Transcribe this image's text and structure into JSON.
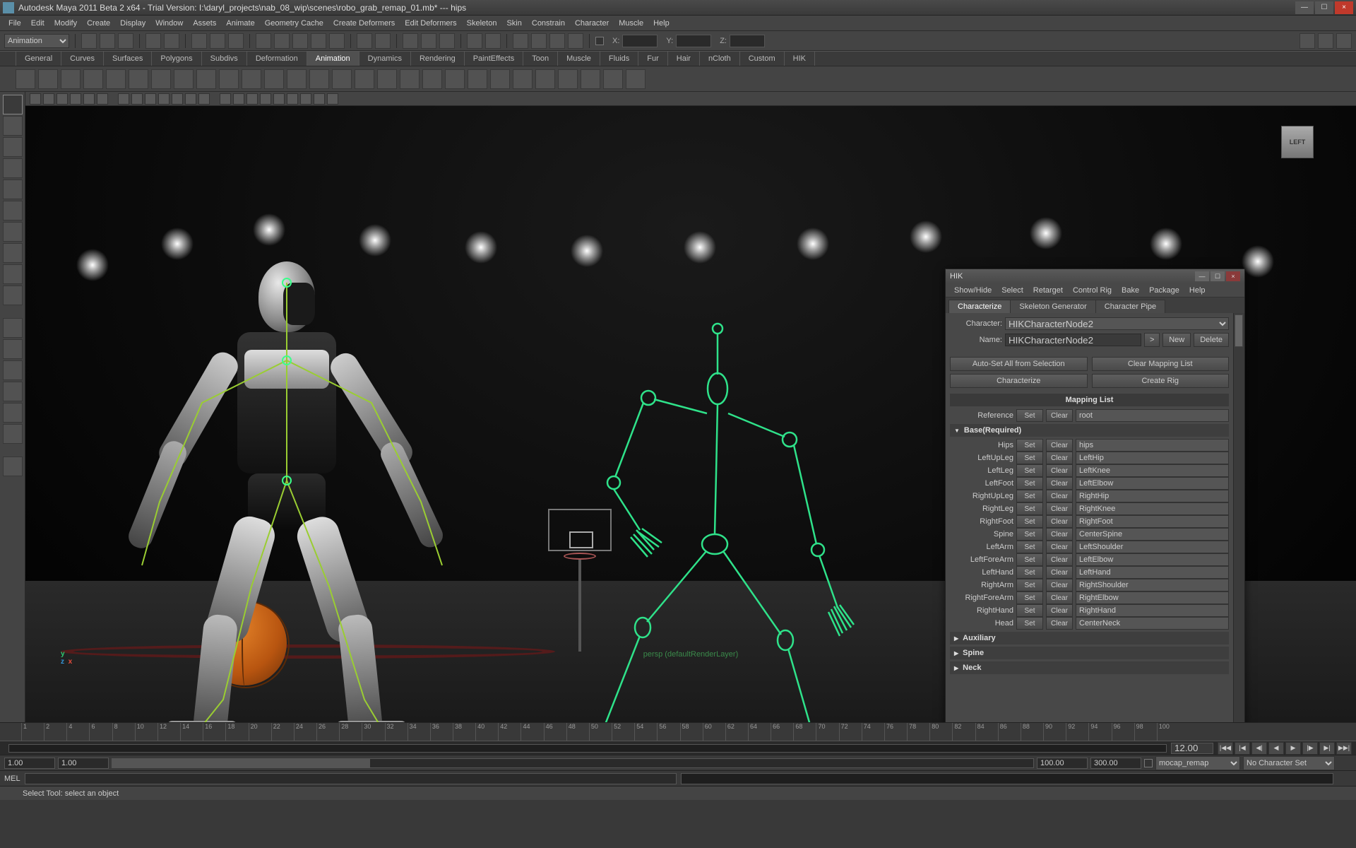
{
  "title": "Autodesk Maya 2011 Beta 2 x64 - Trial Version: I:\\daryl_projects\\nab_08_wip\\scenes\\robo_grab_remap_01.mb*  ---  hips",
  "menubar": [
    "File",
    "Edit",
    "Modify",
    "Create",
    "Display",
    "Window",
    "Assets",
    "Animate",
    "Geometry Cache",
    "Create Deformers",
    "Edit Deformers",
    "Skeleton",
    "Skin",
    "Constrain",
    "Character",
    "Muscle",
    "Help"
  ],
  "modeSelector": "Animation",
  "xyz": {
    "x": "X:",
    "y": "Y:",
    "z": "Z:"
  },
  "shelves": [
    "General",
    "Curves",
    "Surfaces",
    "Polygons",
    "Subdivs",
    "Deformation",
    "Animation",
    "Dynamics",
    "Rendering",
    "PaintEffects",
    "Toon",
    "Muscle",
    "Fluids",
    "Fur",
    "Hair",
    "nCloth",
    "Custom",
    "HIK"
  ],
  "activeShelf": "Animation",
  "viewcube": "LEFT",
  "camlabel": "persp (defaultRenderLayer)",
  "hik": {
    "title": "HIK",
    "menu": [
      "Show/Hide",
      "Select",
      "Retarget",
      "Control Rig",
      "Bake",
      "Package",
      "Help"
    ],
    "tabs": [
      "Characterize",
      "Skeleton Generator",
      "Character Pipe"
    ],
    "activeTab": "Characterize",
    "characterLabel": "Character:",
    "character": "HIKCharacterNode2",
    "nameLabel": "Name:",
    "name": "HIKCharacterNode2",
    "go": ">",
    "newBtn": "New",
    "deleteBtn": "Delete",
    "autoset": "Auto-Set All from Selection",
    "clearmap": "Clear Mapping List",
    "characterize": "Characterize",
    "createrig": "Create Rig",
    "maplist": "Mapping List",
    "setBtn": "Set",
    "clearBtn": "Clear",
    "refLabel": "Reference",
    "refVal": "root",
    "baseHdr": "Base(Required)",
    "rows": [
      {
        "l": "Hips",
        "v": "hips"
      },
      {
        "l": "LeftUpLeg",
        "v": "LeftHip"
      },
      {
        "l": "LeftLeg",
        "v": "LeftKnee"
      },
      {
        "l": "LeftFoot",
        "v": "LeftElbow"
      },
      {
        "l": "RightUpLeg",
        "v": "RightHip"
      },
      {
        "l": "RightLeg",
        "v": "RightKnee"
      },
      {
        "l": "RightFoot",
        "v": "RightFoot"
      },
      {
        "l": "Spine",
        "v": "CenterSpine"
      },
      {
        "l": "LeftArm",
        "v": "LeftShoulder"
      },
      {
        "l": "LeftForeArm",
        "v": "LeftElbow"
      },
      {
        "l": "LeftHand",
        "v": "LeftHand"
      },
      {
        "l": "RightArm",
        "v": "RightShoulder"
      },
      {
        "l": "RightForeArm",
        "v": "RightElbow"
      },
      {
        "l": "RightHand",
        "v": "RightHand"
      },
      {
        "l": "Head",
        "v": "CenterNeck"
      }
    ],
    "auxHdr": "Auxiliary",
    "spineHdr": "Spine",
    "neckHdr": "Neck"
  },
  "time": {
    "ticks": [
      "1",
      "2",
      "4",
      "6",
      "8",
      "10",
      "12",
      "14",
      "16",
      "18",
      "20",
      "22",
      "24",
      "26",
      "28",
      "30",
      "32",
      "34",
      "36",
      "38",
      "40",
      "42",
      "44",
      "46",
      "48",
      "50",
      "52",
      "54",
      "56",
      "58",
      "60",
      "62",
      "64",
      "66",
      "68",
      "70",
      "72",
      "74",
      "76",
      "78",
      "80",
      "82",
      "84",
      "86",
      "88",
      "90",
      "92",
      "94",
      "96",
      "98",
      "100"
    ],
    "current": "12.00",
    "rangeStartOut": "1.00",
    "rangeStart": "1.00",
    "rangeScrubStart": "1",
    "rangeEnd": "100.00",
    "rangeEndOut": "300.00",
    "layer": "mocap_remap",
    "charset": "No Character Set"
  },
  "cmd": {
    "label": "MEL"
  },
  "helpline": "Select Tool: select an object"
}
